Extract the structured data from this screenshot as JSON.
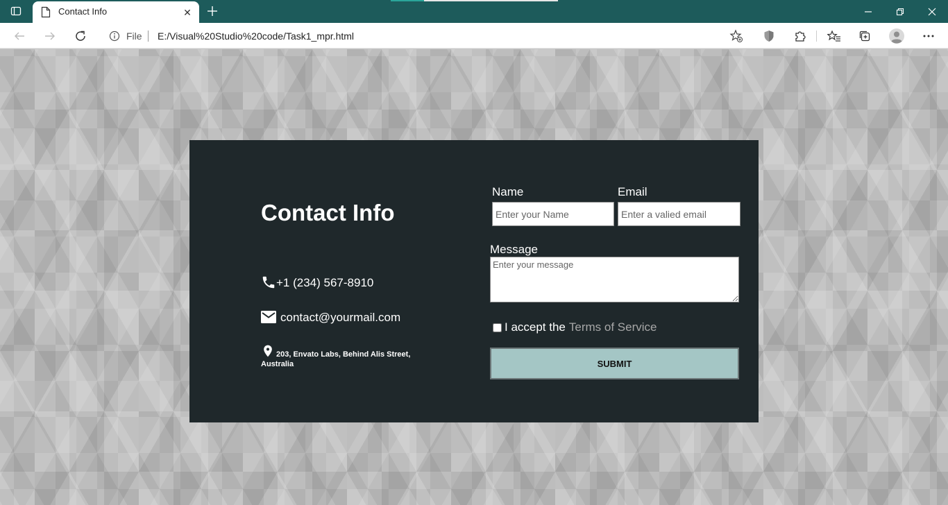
{
  "browser": {
    "tab_title": "Contact Info",
    "address_scheme_label": "File",
    "url": "E:/Visual%20Studio%20code/Task1_mpr.html",
    "frame_color": "#1d5b5b"
  },
  "contact": {
    "title": "Contact Info",
    "phone": "+1 (234) 567-8910",
    "email": "contact@yourmail.com",
    "address": "203, Envato Labs, Behind Alis Street, Australia",
    "card_color": "#1f282b"
  },
  "form": {
    "name_label": "Name",
    "name_placeholder": "Enter your Name",
    "email_label": "Email",
    "email_placeholder": "Enter a valied email",
    "message_label": "Message",
    "message_placeholder": "Enter your message",
    "terms_prefix": "I accept the",
    "terms_link": "Terms of Service",
    "submit_label": "SUBMIT",
    "submit_color": "#a4c6c5"
  }
}
